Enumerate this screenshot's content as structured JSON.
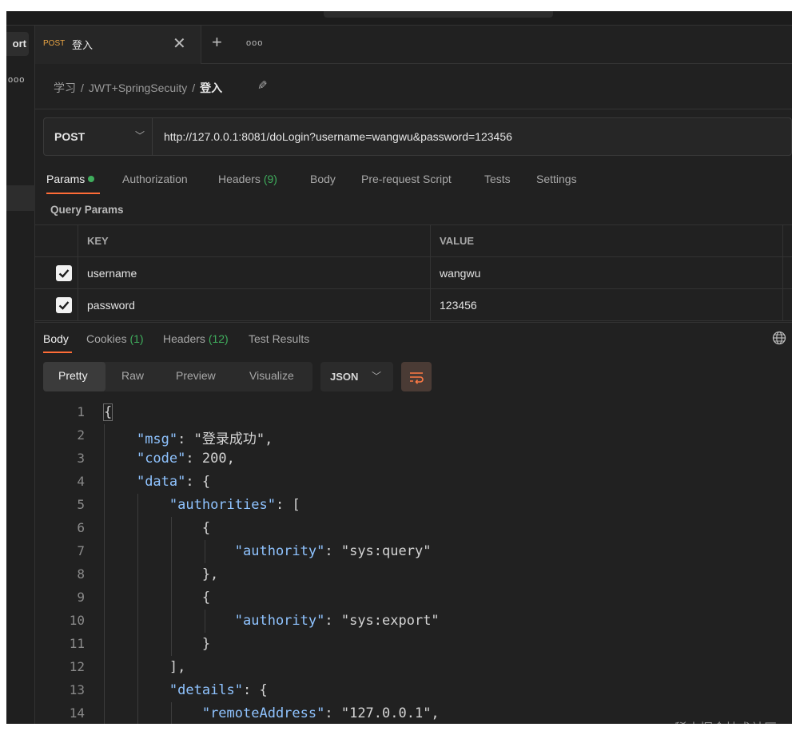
{
  "sidebar": {
    "import_label": "ort",
    "more": "ooo"
  },
  "tab": {
    "method": "POST",
    "title": "登入",
    "close": "✕",
    "new_tab": "+",
    "more": "ooo"
  },
  "breadcrumb": {
    "items": [
      "学习",
      "JWT+SpringSecuity"
    ],
    "separator": "/",
    "current": "登入"
  },
  "request": {
    "method": "POST",
    "url": "http://127.0.0.1:8081/doLogin?username=wangwu&password=123456"
  },
  "request_tabs": {
    "params": "Params",
    "authorization": "Authorization",
    "headers": "Headers",
    "headers_count": "(9)",
    "body": "Body",
    "prerequest": "Pre-request Script",
    "tests": "Tests",
    "settings": "Settings"
  },
  "query_params": {
    "title": "Query Params",
    "key_header": "KEY",
    "value_header": "VALUE",
    "rows": [
      {
        "key": "username",
        "value": "wangwu",
        "checked": true
      },
      {
        "key": "password",
        "value": "123456",
        "checked": true
      }
    ]
  },
  "response_tabs": {
    "body": "Body",
    "cookies": "Cookies",
    "cookies_count": "(1)",
    "headers": "Headers",
    "headers_count": "(12)",
    "test_results": "Test Results"
  },
  "format": {
    "pretty": "Pretty",
    "raw": "Raw",
    "preview": "Preview",
    "visualize": "Visualize",
    "language": "JSON"
  },
  "code_lines": [
    {
      "n": "1",
      "t": "{"
    },
    {
      "n": "2",
      "t": "    \"msg\": \"登录成功\","
    },
    {
      "n": "3",
      "t": "    \"code\": 200,"
    },
    {
      "n": "4",
      "t": "    \"data\": {"
    },
    {
      "n": "5",
      "t": "        \"authorities\": ["
    },
    {
      "n": "6",
      "t": "            {"
    },
    {
      "n": "7",
      "t": "                \"authority\": \"sys:query\""
    },
    {
      "n": "8",
      "t": "            },"
    },
    {
      "n": "9",
      "t": "            {"
    },
    {
      "n": "10",
      "t": "                \"authority\": \"sys:export\""
    },
    {
      "n": "11",
      "t": "            }"
    },
    {
      "n": "12",
      "t": "        ],"
    },
    {
      "n": "13",
      "t": "        \"details\": {"
    },
    {
      "n": "14",
      "t": "            \"remoteAddress\": \"127.0.0.1\","
    }
  ],
  "watermark": "@稀土掘金技术社区",
  "colors": {
    "accent": "#ff6c37",
    "count_green": "#3fae5d",
    "method_orange": "#e8a444",
    "json_key": "#8fc3ff",
    "json_string": "#e9b57a",
    "json_number": "#b5cea8"
  }
}
